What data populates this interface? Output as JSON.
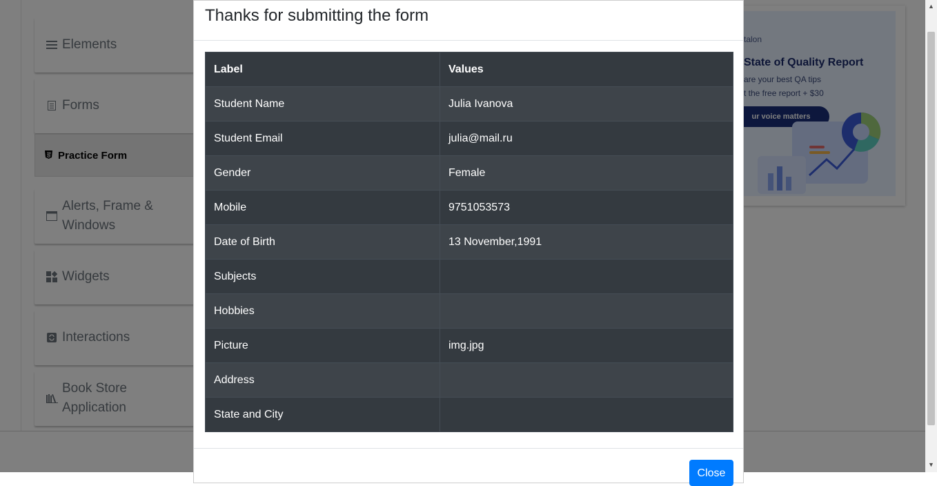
{
  "sidebar": {
    "groups": [
      {
        "label": "Elements",
        "icon": "hamburger-icon"
      },
      {
        "label": "Forms",
        "icon": "document-icon"
      },
      {
        "label": "Alerts, Frame & Windows",
        "icon": "window-icon"
      },
      {
        "label": "Widgets",
        "icon": "widgets-icon"
      },
      {
        "label": "Interactions",
        "icon": "refresh-icon"
      },
      {
        "label": "Book Store Application",
        "icon": "books-icon"
      }
    ],
    "active_item": {
      "label": "Practice Form",
      "icon": "html5-icon"
    }
  },
  "ad": {
    "brand": "talon",
    "title": "State of Quality Report",
    "line1": "are your best QA tips",
    "line2": "t the free report + $30",
    "button": "ur voice matters"
  },
  "modal": {
    "title": "Thanks for submitting the form",
    "table": {
      "headers": [
        "Label",
        "Values"
      ],
      "rows": [
        {
          "label": "Student Name",
          "value": "Julia Ivanova"
        },
        {
          "label": "Student Email",
          "value": "julia@mail.ru"
        },
        {
          "label": "Gender",
          "value": "Female"
        },
        {
          "label": "Mobile",
          "value": "9751053573"
        },
        {
          "label": "Date of Birth",
          "value": "13 November,1991"
        },
        {
          "label": "Subjects",
          "value": ""
        },
        {
          "label": "Hobbies",
          "value": ""
        },
        {
          "label": "Picture",
          "value": "img.jpg"
        },
        {
          "label": "Address",
          "value": ""
        },
        {
          "label": "State and City",
          "value": ""
        }
      ]
    },
    "close_label": "Close"
  },
  "colors": {
    "accent": "#007bff",
    "table_dark": "#343a40",
    "table_stripe": "#3e444a",
    "backdrop": "#000000"
  }
}
